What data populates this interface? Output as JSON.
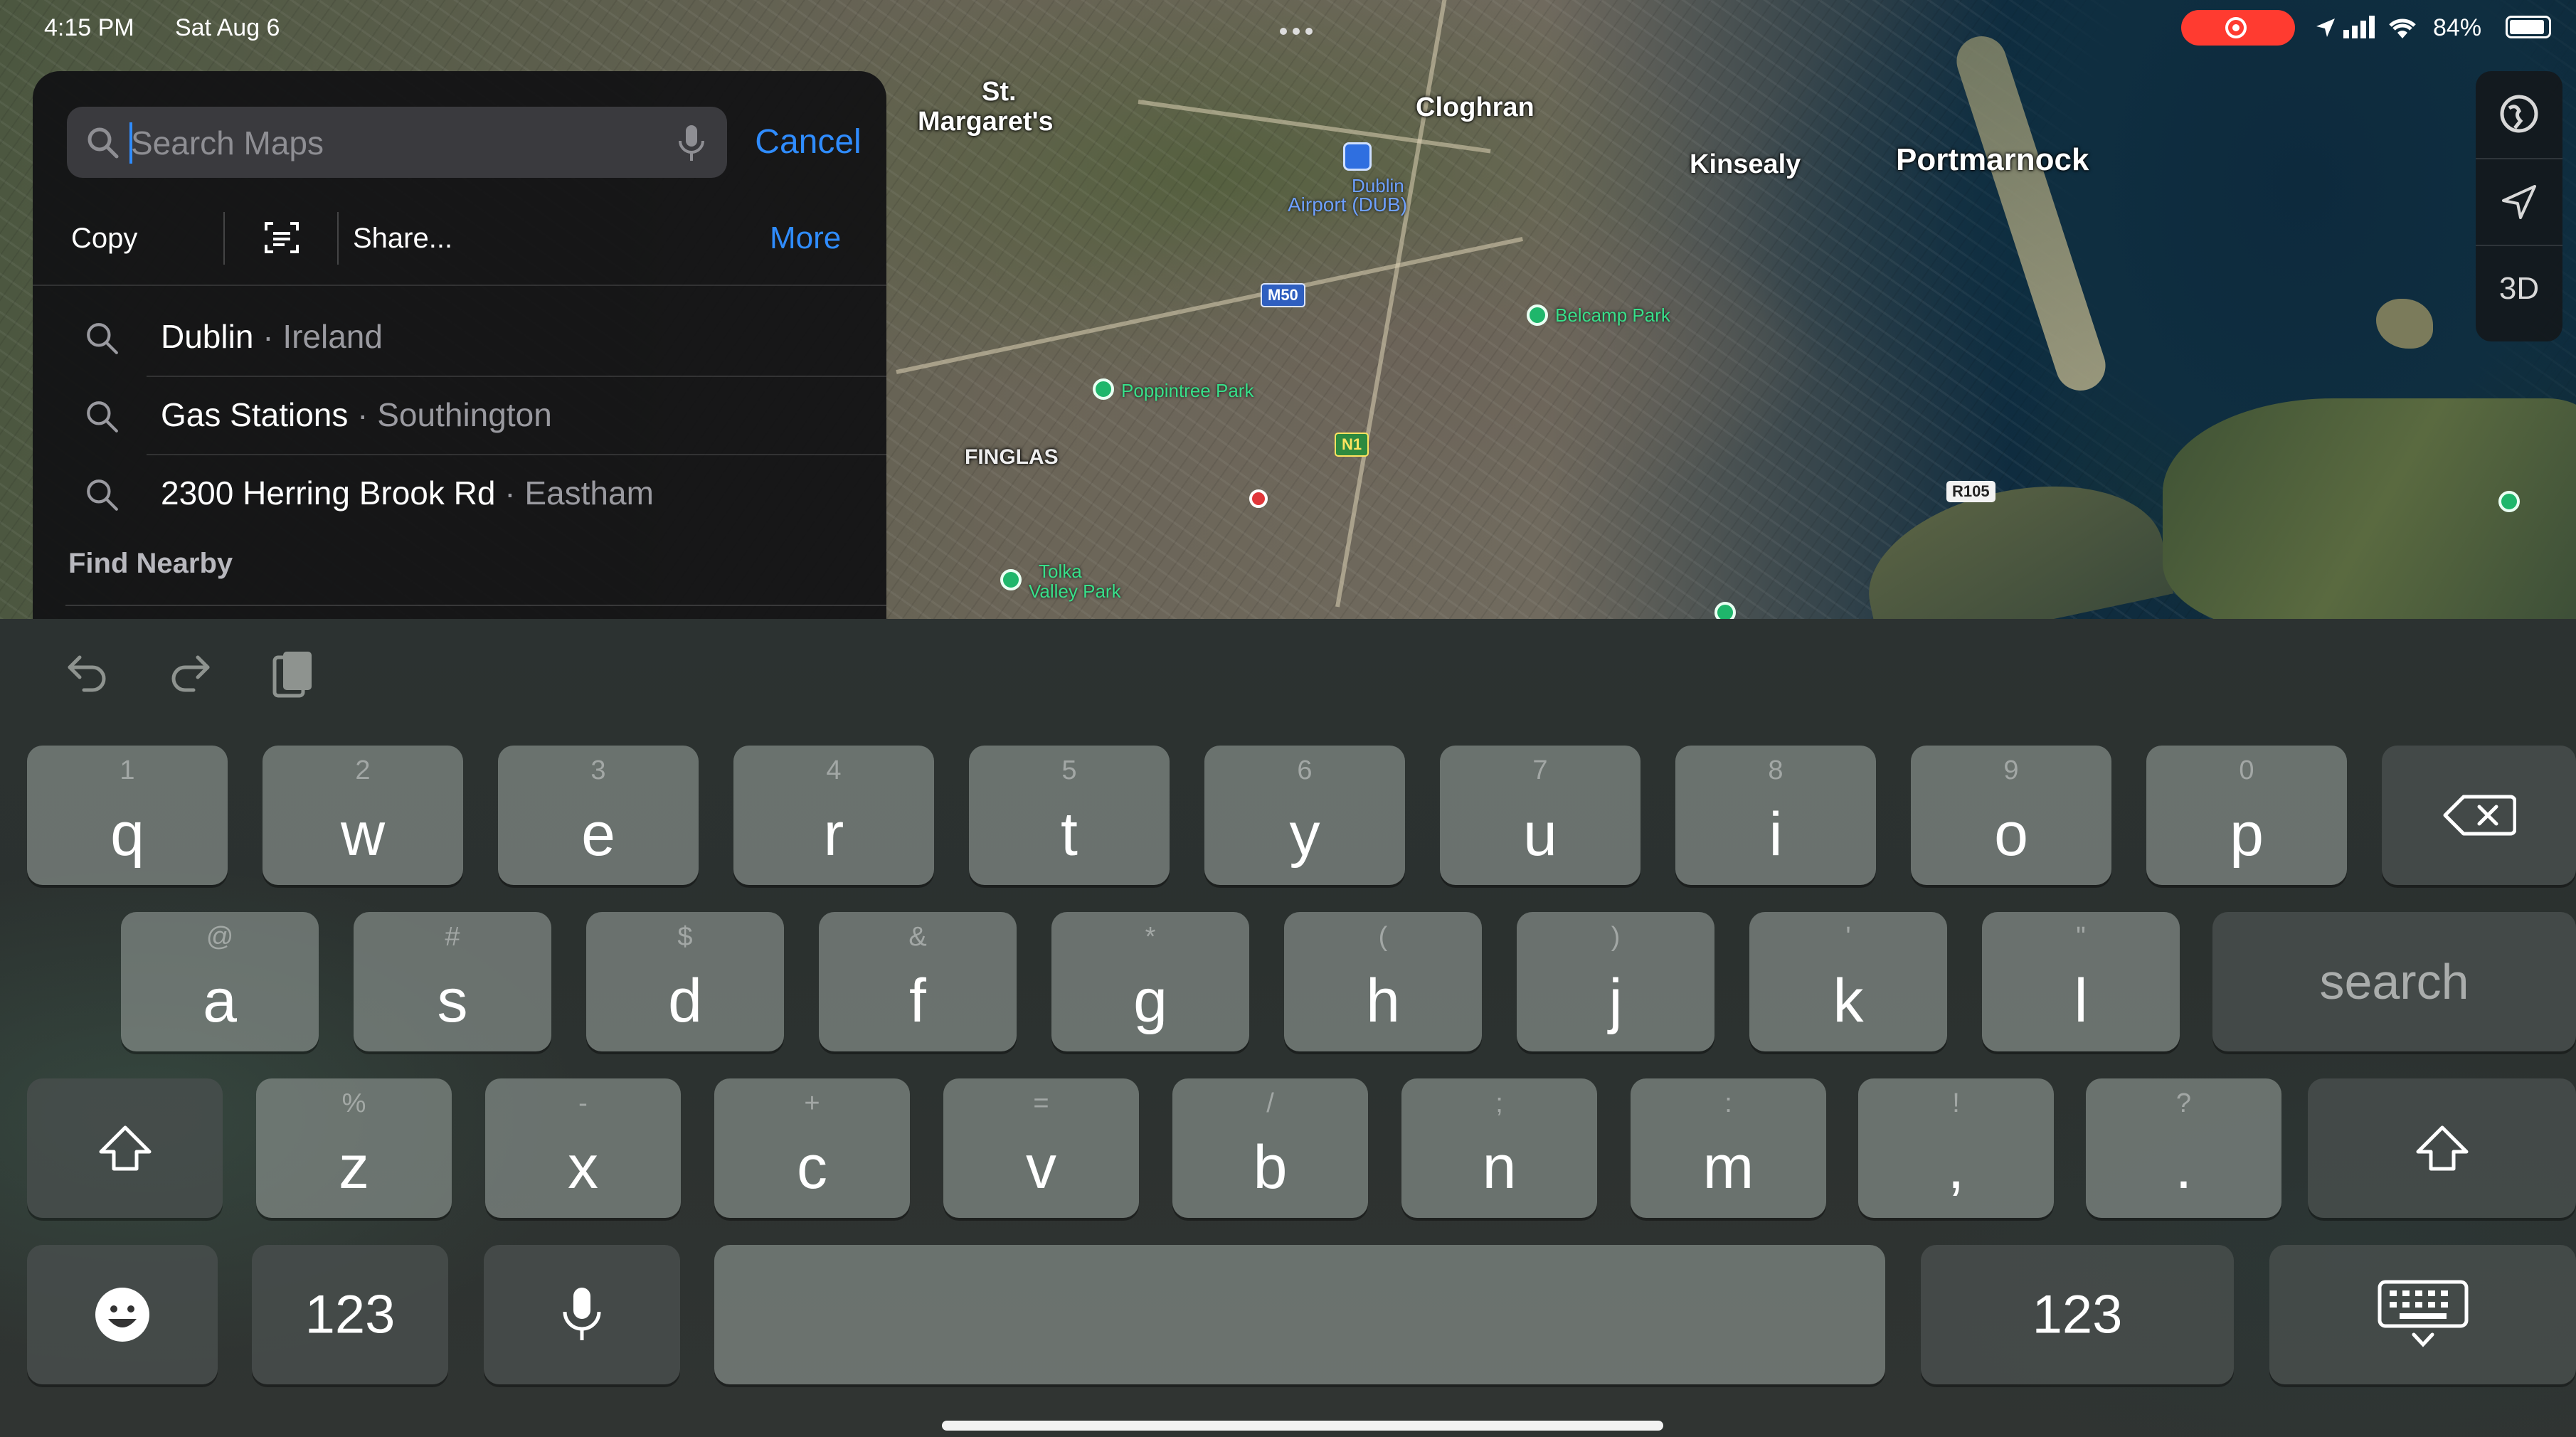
{
  "status_bar": {
    "time": "4:15 PM",
    "date": "Sat Aug 6",
    "battery": "84%"
  },
  "map": {
    "labels": [
      {
        "id": "st-margarets-1",
        "text": "St."
      },
      {
        "id": "st-margarets-2",
        "text": "Margaret's"
      },
      {
        "id": "cloghran",
        "text": "Cloghran"
      },
      {
        "id": "kinsealy",
        "text": "Kinsealy"
      },
      {
        "id": "portmarnock",
        "text": "Portmarnock"
      },
      {
        "id": "finglas",
        "text": "FINGLAS"
      },
      {
        "id": "airport-1",
        "text": "Dublin"
      },
      {
        "id": "airport-2",
        "text": "Airport (DUB)"
      }
    ],
    "pois": [
      {
        "id": "belcamp",
        "text": "Belcamp Park"
      },
      {
        "id": "poppintree",
        "text": "Poppintree Park"
      },
      {
        "id": "tolka-1",
        "text": "Tolka"
      },
      {
        "id": "tolka-2",
        "text": "Valley Park"
      }
    ],
    "road_shields": [
      {
        "id": "m50",
        "text": "M50"
      },
      {
        "id": "n1",
        "text": "N1"
      },
      {
        "id": "r105",
        "text": "R105"
      }
    ],
    "controls": {
      "three_d": "3D"
    }
  },
  "search_panel": {
    "placeholder": "Search Maps",
    "cancel_label": "Cancel",
    "menu": {
      "copy": "Copy",
      "share": "Share...",
      "more": "More"
    },
    "recents": [
      {
        "main": "Dublin",
        "sub": "Ireland"
      },
      {
        "main": "Gas Stations",
        "sub": "Southington"
      },
      {
        "main": "2300 Herring Brook Rd",
        "sub": "Eastham"
      }
    ],
    "separator": " · ",
    "find_nearby": "Find Nearby"
  },
  "keyboard": {
    "row1": [
      {
        "key": "q",
        "alt": "1"
      },
      {
        "key": "w",
        "alt": "2"
      },
      {
        "key": "e",
        "alt": "3"
      },
      {
        "key": "r",
        "alt": "4"
      },
      {
        "key": "t",
        "alt": "5"
      },
      {
        "key": "y",
        "alt": "6"
      },
      {
        "key": "u",
        "alt": "7"
      },
      {
        "key": "i",
        "alt": "8"
      },
      {
        "key": "o",
        "alt": "9"
      },
      {
        "key": "p",
        "alt": "0"
      }
    ],
    "row2": [
      {
        "key": "a",
        "alt": "@"
      },
      {
        "key": "s",
        "alt": "#"
      },
      {
        "key": "d",
        "alt": "$"
      },
      {
        "key": "f",
        "alt": "&"
      },
      {
        "key": "g",
        "alt": "*"
      },
      {
        "key": "h",
        "alt": "("
      },
      {
        "key": "j",
        "alt": ")"
      },
      {
        "key": "k",
        "alt": "'"
      },
      {
        "key": "l",
        "alt": "\""
      }
    ],
    "row3": [
      {
        "key": "z",
        "alt": "%"
      },
      {
        "key": "x",
        "alt": "-"
      },
      {
        "key": "c",
        "alt": "+"
      },
      {
        "key": "v",
        "alt": "="
      },
      {
        "key": "b",
        "alt": "/"
      },
      {
        "key": "n",
        "alt": ";"
      },
      {
        "key": "m",
        "alt": ":"
      }
    ],
    "punct": [
      {
        "key": ",",
        "alt": "!"
      },
      {
        "key": ".",
        "alt": "?"
      }
    ],
    "search_label": "search",
    "numbers_label": "123"
  }
}
